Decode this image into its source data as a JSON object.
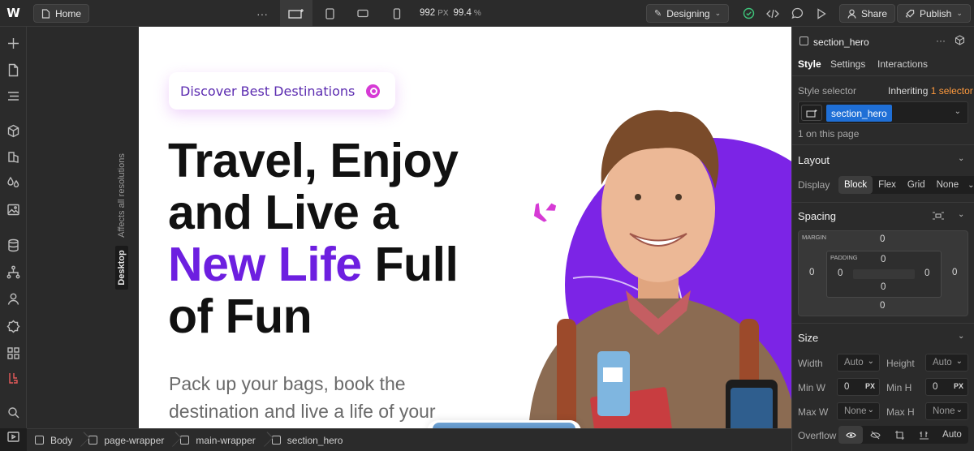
{
  "topbar": {
    "home_label": "Home",
    "more_label": "···",
    "width_value": "992",
    "width_unit": "PX",
    "zoom_value": "99.4",
    "zoom_unit": "%",
    "mode_label": "Designing",
    "share_label": "Share",
    "publish_label": "Publish"
  },
  "canvas": {
    "gutter_label_affects": "Affects all resolutions",
    "gutter_label_breakpoint": "Desktop",
    "pill_text": "Discover Best Destinations",
    "title_line1": "Travel, Enjoy",
    "title_line2": "and Live a",
    "title_highlight": "New Life",
    "title_line3_rest": " Full",
    "title_line4": "of Fun",
    "subtitle": "Pack up your bags, book the destination and live a life of your",
    "accent_color": "#6d1fe0"
  },
  "panel": {
    "element_name": "section_hero",
    "tabs": [
      "Style",
      "Settings",
      "Interactions"
    ],
    "style_selector_label": "Style selector",
    "inheriting_label": "Inheriting",
    "inheriting_count": "1 selector",
    "selector_tag": "section_hero",
    "on_page": "1 on this page",
    "layout": {
      "title": "Layout",
      "display_label": "Display",
      "display_options": [
        "Block",
        "Flex",
        "Grid",
        "None"
      ],
      "display_selected": "Block"
    },
    "spacing": {
      "title": "Spacing",
      "margin_label": "MARGIN",
      "padding_label": "PADDING",
      "margin_top": "0",
      "margin_right": "0",
      "margin_bottom": "0",
      "margin_left": "0",
      "padding_top": "0",
      "padding_right": "0",
      "padding_bottom": "0",
      "padding_left": "0"
    },
    "size": {
      "title": "Size",
      "width_label": "Width",
      "width_value": "Auto",
      "height_label": "Height",
      "height_value": "Auto",
      "minw_label": "Min W",
      "minw_value": "0",
      "minw_unit": "PX",
      "minh_label": "Min H",
      "minh_value": "0",
      "minh_unit": "PX",
      "maxw_label": "Max W",
      "maxw_value": "None",
      "maxh_label": "Max H",
      "maxh_value": "None",
      "overflow_label": "Overflow",
      "overflow_auto": "Auto"
    }
  },
  "breadcrumb": [
    "Body",
    "page-wrapper",
    "main-wrapper",
    "section_hero"
  ]
}
